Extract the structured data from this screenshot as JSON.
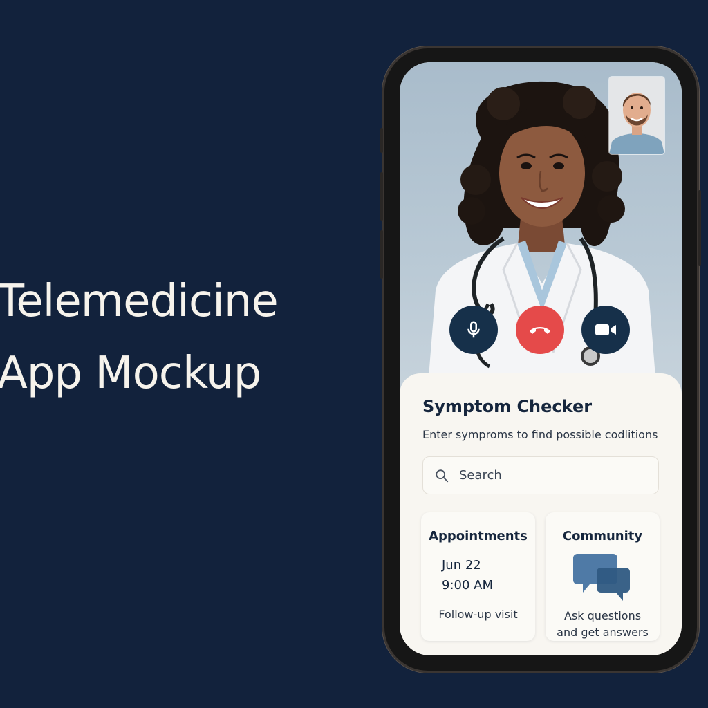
{
  "headline": {
    "line1": "Telemedicine",
    "line2": "App Mockup"
  },
  "call": {
    "doctor_video": "doctor-portrait",
    "self_video": "patient-thumbnail",
    "controls": {
      "mute_icon": "microphone-icon",
      "end_icon": "hang-up-icon",
      "camera_icon": "video-camera-icon"
    }
  },
  "symptom_checker": {
    "title": "Symptom Checker",
    "subtitle": "Enter symproms to find possible codlitions",
    "search_placeholder": "Search"
  },
  "cards": {
    "appointments": {
      "title": "Appointments",
      "date": "Jun 22",
      "time": "9:00 AM",
      "note": "Follow-up visit"
    },
    "community": {
      "title": "Community",
      "note_line1": "Ask questions",
      "note_line2": "and get answers",
      "icon": "chat-bubbles-icon"
    }
  },
  "colors": {
    "background": "#12223c",
    "accent_dark": "#16304a",
    "end_call": "#e54a4a",
    "sheet": "#f8f6f1"
  }
}
